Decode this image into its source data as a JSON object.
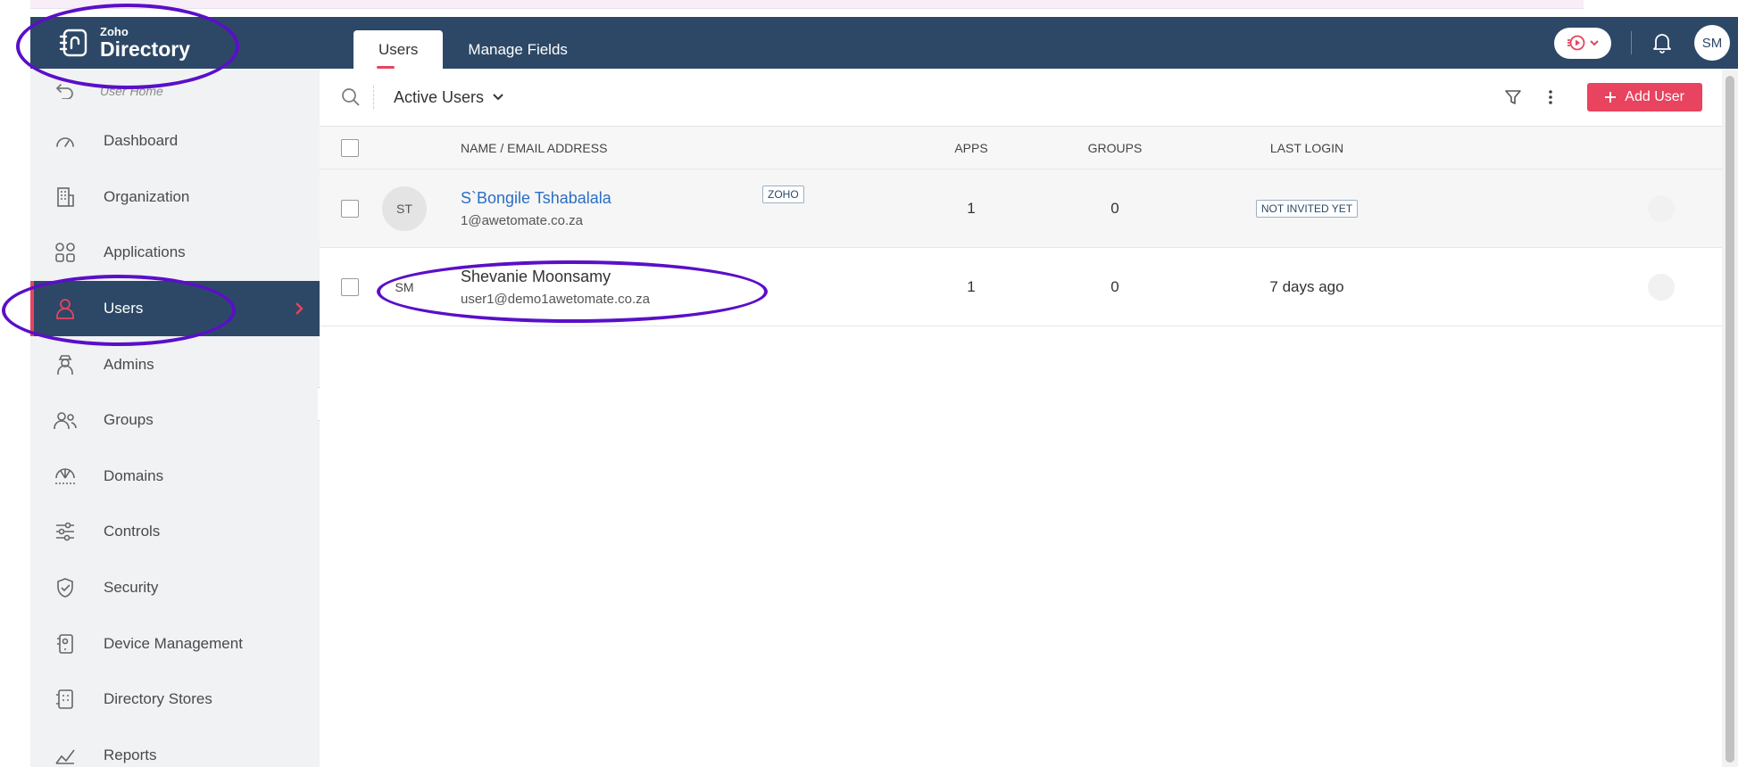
{
  "header": {
    "logo_brand": "Zoho",
    "logo_product": "Directory",
    "tabs": [
      {
        "label": "Users",
        "active": true
      },
      {
        "label": "Manage Fields",
        "active": false
      }
    ],
    "user_initials": "SM"
  },
  "sidebar": {
    "back_label": "User Home",
    "items": [
      {
        "label": "Dashboard",
        "icon": "gauge-icon"
      },
      {
        "label": "Organization",
        "icon": "organization-icon"
      },
      {
        "label": "Applications",
        "icon": "grid-icon"
      },
      {
        "label": "Users",
        "icon": "user-icon",
        "active": true
      },
      {
        "label": "Admins",
        "icon": "admin-icon"
      },
      {
        "label": "Groups",
        "icon": "group-icon"
      },
      {
        "label": "Domains",
        "icon": "globe-icon"
      },
      {
        "label": "Controls",
        "icon": "sliders-icon"
      },
      {
        "label": "Security",
        "icon": "shield-icon"
      },
      {
        "label": "Device Management",
        "icon": "device-icon"
      },
      {
        "label": "Directory Stores",
        "icon": "store-icon"
      },
      {
        "label": "Reports",
        "icon": "chart-icon"
      }
    ]
  },
  "toolbar": {
    "view_label": "Active Users",
    "add_user_label": "Add User"
  },
  "table": {
    "columns": [
      "NAME / EMAIL ADDRESS",
      "APPS",
      "GROUPS",
      "LAST LOGIN"
    ],
    "rows": [
      {
        "initials": "ST",
        "name": "S`Bongile Tshabalala",
        "email": "1@awetomate.co.za",
        "tag": "ZOHO",
        "apps": "1",
        "groups": "0",
        "last_login": "NOT INVITED YET"
      },
      {
        "initials": "SM",
        "name": "Shevanie Moonsamy",
        "email": "user1@demo1awetomate.co.za",
        "tag": "",
        "apps": "1",
        "groups": "0",
        "last_login": "7 days ago"
      }
    ]
  },
  "colors": {
    "header_bg": "#2c4866",
    "accent": "#e8435f",
    "link": "#2b6ec6",
    "annotation": "#5a0fc8"
  }
}
